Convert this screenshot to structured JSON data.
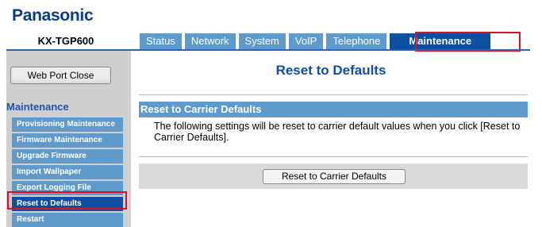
{
  "header": {
    "brand": "Panasonic",
    "model": "KX-TGP600"
  },
  "tabs": [
    {
      "label": "Status",
      "active": false
    },
    {
      "label": "Network",
      "active": false
    },
    {
      "label": "System",
      "active": false
    },
    {
      "label": "VoIP",
      "active": false
    },
    {
      "label": "Telephone",
      "active": false
    },
    {
      "label": "Maintenance",
      "active": true
    }
  ],
  "sidebar": {
    "web_port_close_label": "Web Port Close",
    "menu_title": "Maintenance",
    "items": [
      {
        "label": "Provisioning Maintenance"
      },
      {
        "label": "Firmware Maintenance"
      },
      {
        "label": "Upgrade Firmware"
      },
      {
        "label": "Import Wallpaper"
      },
      {
        "label": "Export Logging File"
      },
      {
        "label": "Reset to Defaults",
        "current": true
      },
      {
        "label": "Restart"
      }
    ]
  },
  "main": {
    "title": "Reset to Defaults",
    "section_title": "Reset to Carrier Defaults",
    "description": "The following settings will be reset to carrier default values when you click [Reset to Carrier Defaults].",
    "button_label": "Reset to Carrier Defaults"
  },
  "colors": {
    "tab": "#5f9acd",
    "tab_active": "#0d4fa3",
    "highlight": "#e3101b",
    "brand": "#0b3c8c"
  }
}
